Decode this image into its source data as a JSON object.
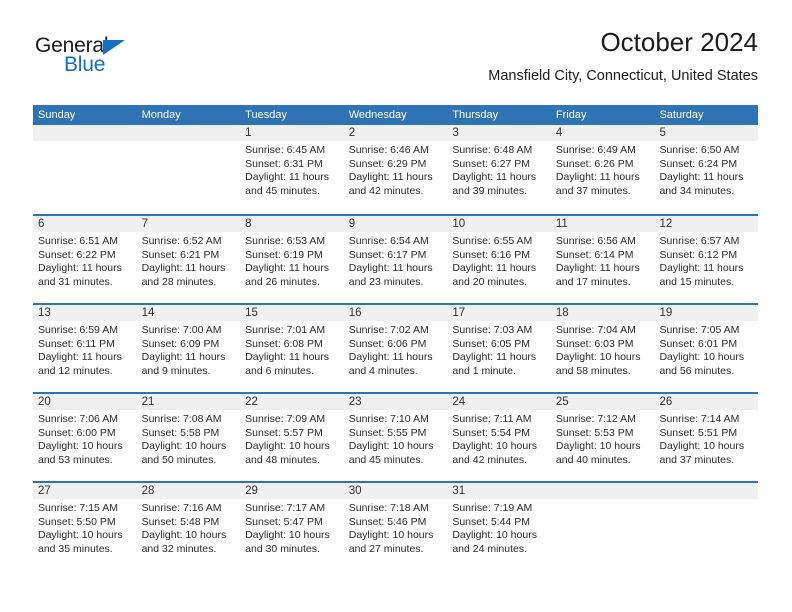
{
  "brand": {
    "name_top": "General",
    "name_bottom": "Blue",
    "accent_color": "#1272c0"
  },
  "header": {
    "title": "October 2024",
    "subtitle": "Mansfield City, Connecticut, United States"
  },
  "theme": {
    "header_bar_color": "#2e74b5",
    "daynum_band_color": "#f0f0f0",
    "text_color": "#2b2b2b"
  },
  "calendar": {
    "weekday_headers": [
      "Sunday",
      "Monday",
      "Tuesday",
      "Wednesday",
      "Thursday",
      "Friday",
      "Saturday"
    ],
    "weeks": [
      [
        {
          "day": "",
          "sunrise": "",
          "sunset": "",
          "daylight": ""
        },
        {
          "day": "",
          "sunrise": "",
          "sunset": "",
          "daylight": ""
        },
        {
          "day": "1",
          "sunrise": "Sunrise: 6:45 AM",
          "sunset": "Sunset: 6:31 PM",
          "daylight": "Daylight: 11 hours and 45 minutes."
        },
        {
          "day": "2",
          "sunrise": "Sunrise: 6:46 AM",
          "sunset": "Sunset: 6:29 PM",
          "daylight": "Daylight: 11 hours and 42 minutes."
        },
        {
          "day": "3",
          "sunrise": "Sunrise: 6:48 AM",
          "sunset": "Sunset: 6:27 PM",
          "daylight": "Daylight: 11 hours and 39 minutes."
        },
        {
          "day": "4",
          "sunrise": "Sunrise: 6:49 AM",
          "sunset": "Sunset: 6:26 PM",
          "daylight": "Daylight: 11 hours and 37 minutes."
        },
        {
          "day": "5",
          "sunrise": "Sunrise: 6:50 AM",
          "sunset": "Sunset: 6:24 PM",
          "daylight": "Daylight: 11 hours and 34 minutes."
        }
      ],
      [
        {
          "day": "6",
          "sunrise": "Sunrise: 6:51 AM",
          "sunset": "Sunset: 6:22 PM",
          "daylight": "Daylight: 11 hours and 31 minutes."
        },
        {
          "day": "7",
          "sunrise": "Sunrise: 6:52 AM",
          "sunset": "Sunset: 6:21 PM",
          "daylight": "Daylight: 11 hours and 28 minutes."
        },
        {
          "day": "8",
          "sunrise": "Sunrise: 6:53 AM",
          "sunset": "Sunset: 6:19 PM",
          "daylight": "Daylight: 11 hours and 26 minutes."
        },
        {
          "day": "9",
          "sunrise": "Sunrise: 6:54 AM",
          "sunset": "Sunset: 6:17 PM",
          "daylight": "Daylight: 11 hours and 23 minutes."
        },
        {
          "day": "10",
          "sunrise": "Sunrise: 6:55 AM",
          "sunset": "Sunset: 6:16 PM",
          "daylight": "Daylight: 11 hours and 20 minutes."
        },
        {
          "day": "11",
          "sunrise": "Sunrise: 6:56 AM",
          "sunset": "Sunset: 6:14 PM",
          "daylight": "Daylight: 11 hours and 17 minutes."
        },
        {
          "day": "12",
          "sunrise": "Sunrise: 6:57 AM",
          "sunset": "Sunset: 6:12 PM",
          "daylight": "Daylight: 11 hours and 15 minutes."
        }
      ],
      [
        {
          "day": "13",
          "sunrise": "Sunrise: 6:59 AM",
          "sunset": "Sunset: 6:11 PM",
          "daylight": "Daylight: 11 hours and 12 minutes."
        },
        {
          "day": "14",
          "sunrise": "Sunrise: 7:00 AM",
          "sunset": "Sunset: 6:09 PM",
          "daylight": "Daylight: 11 hours and 9 minutes."
        },
        {
          "day": "15",
          "sunrise": "Sunrise: 7:01 AM",
          "sunset": "Sunset: 6:08 PM",
          "daylight": "Daylight: 11 hours and 6 minutes."
        },
        {
          "day": "16",
          "sunrise": "Sunrise: 7:02 AM",
          "sunset": "Sunset: 6:06 PM",
          "daylight": "Daylight: 11 hours and 4 minutes."
        },
        {
          "day": "17",
          "sunrise": "Sunrise: 7:03 AM",
          "sunset": "Sunset: 6:05 PM",
          "daylight": "Daylight: 11 hours and 1 minute."
        },
        {
          "day": "18",
          "sunrise": "Sunrise: 7:04 AM",
          "sunset": "Sunset: 6:03 PM",
          "daylight": "Daylight: 10 hours and 58 minutes."
        },
        {
          "day": "19",
          "sunrise": "Sunrise: 7:05 AM",
          "sunset": "Sunset: 6:01 PM",
          "daylight": "Daylight: 10 hours and 56 minutes."
        }
      ],
      [
        {
          "day": "20",
          "sunrise": "Sunrise: 7:06 AM",
          "sunset": "Sunset: 6:00 PM",
          "daylight": "Daylight: 10 hours and 53 minutes."
        },
        {
          "day": "21",
          "sunrise": "Sunrise: 7:08 AM",
          "sunset": "Sunset: 5:58 PM",
          "daylight": "Daylight: 10 hours and 50 minutes."
        },
        {
          "day": "22",
          "sunrise": "Sunrise: 7:09 AM",
          "sunset": "Sunset: 5:57 PM",
          "daylight": "Daylight: 10 hours and 48 minutes."
        },
        {
          "day": "23",
          "sunrise": "Sunrise: 7:10 AM",
          "sunset": "Sunset: 5:55 PM",
          "daylight": "Daylight: 10 hours and 45 minutes."
        },
        {
          "day": "24",
          "sunrise": "Sunrise: 7:11 AM",
          "sunset": "Sunset: 5:54 PM",
          "daylight": "Daylight: 10 hours and 42 minutes."
        },
        {
          "day": "25",
          "sunrise": "Sunrise: 7:12 AM",
          "sunset": "Sunset: 5:53 PM",
          "daylight": "Daylight: 10 hours and 40 minutes."
        },
        {
          "day": "26",
          "sunrise": "Sunrise: 7:14 AM",
          "sunset": "Sunset: 5:51 PM",
          "daylight": "Daylight: 10 hours and 37 minutes."
        }
      ],
      [
        {
          "day": "27",
          "sunrise": "Sunrise: 7:15 AM",
          "sunset": "Sunset: 5:50 PM",
          "daylight": "Daylight: 10 hours and 35 minutes."
        },
        {
          "day": "28",
          "sunrise": "Sunrise: 7:16 AM",
          "sunset": "Sunset: 5:48 PM",
          "daylight": "Daylight: 10 hours and 32 minutes."
        },
        {
          "day": "29",
          "sunrise": "Sunrise: 7:17 AM",
          "sunset": "Sunset: 5:47 PM",
          "daylight": "Daylight: 10 hours and 30 minutes."
        },
        {
          "day": "30",
          "sunrise": "Sunrise: 7:18 AM",
          "sunset": "Sunset: 5:46 PM",
          "daylight": "Daylight: 10 hours and 27 minutes."
        },
        {
          "day": "31",
          "sunrise": "Sunrise: 7:19 AM",
          "sunset": "Sunset: 5:44 PM",
          "daylight": "Daylight: 10 hours and 24 minutes."
        },
        {
          "day": "",
          "sunrise": "",
          "sunset": "",
          "daylight": ""
        },
        {
          "day": "",
          "sunrise": "",
          "sunset": "",
          "daylight": ""
        }
      ]
    ]
  }
}
